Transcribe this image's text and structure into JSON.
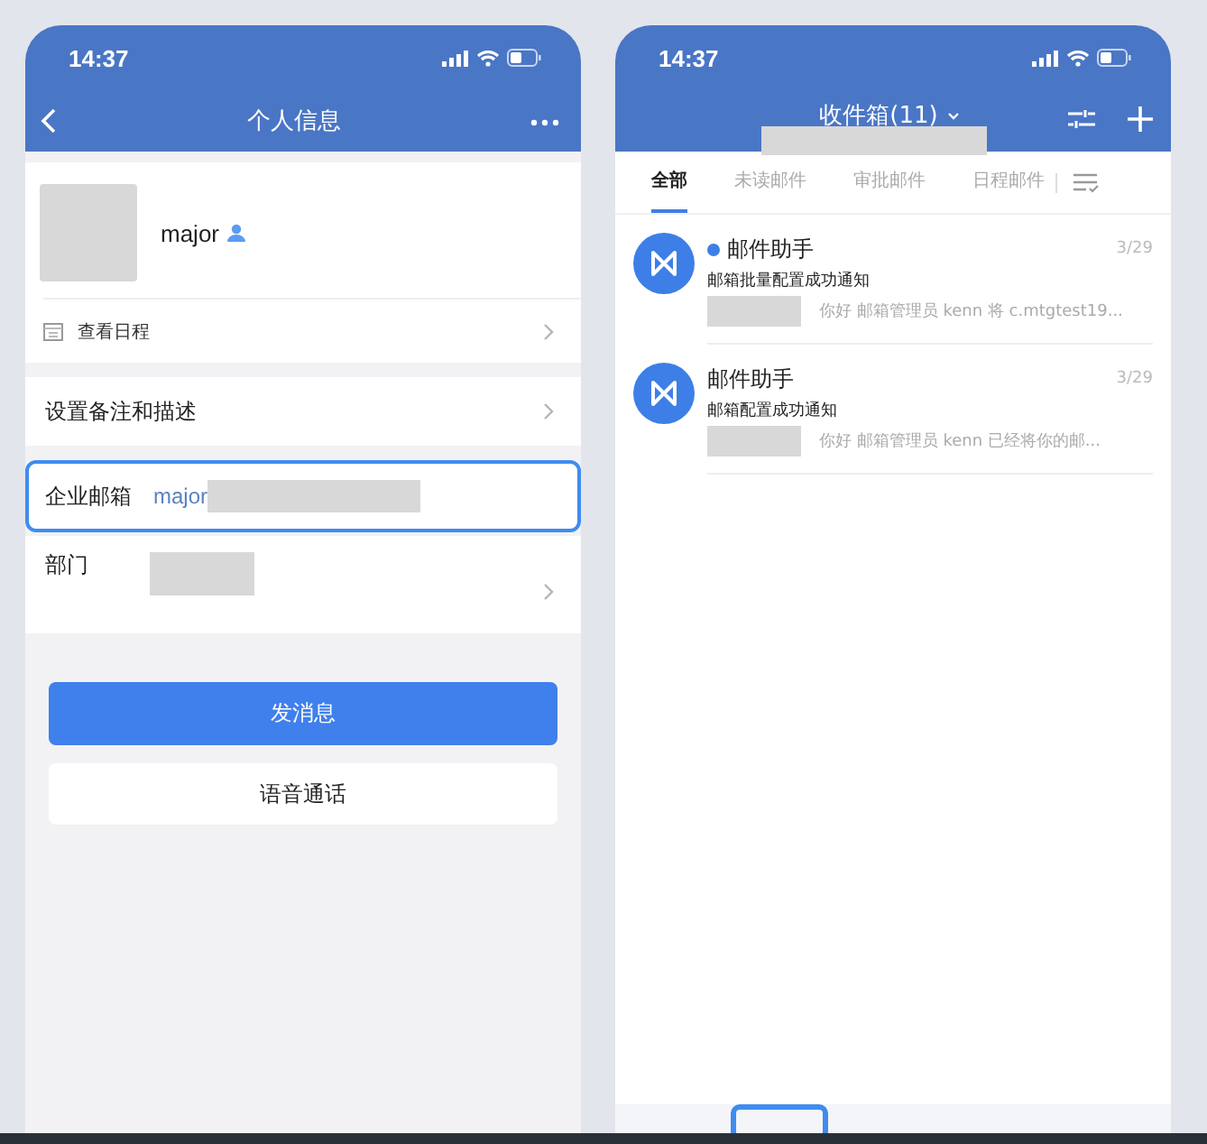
{
  "left_phone": {
    "status_bar": {
      "time": "14:37"
    },
    "nav": {
      "title": "个人信息"
    },
    "profile": {
      "name": "major",
      "schedule_link": "查看日程"
    },
    "rows": [
      {
        "kind": "link",
        "label": "设置备注和描述",
        "highlighted": false
      },
      {
        "kind": "field",
        "label": "企业邮箱",
        "value": "major",
        "redacted": true,
        "highlighted": true
      },
      {
        "kind": "department",
        "label": "部门",
        "redacted": true,
        "highlighted": false
      }
    ],
    "buttons": [
      {
        "label": "发消息",
        "kind": "primary"
      },
      {
        "label": "语音通话",
        "kind": "secondary"
      }
    ]
  },
  "right_phone": {
    "status_bar": {
      "time": "14:37"
    },
    "nav": {
      "title": "收件箱(11)",
      "subtitle_redacted": true
    },
    "tabs": [
      {
        "label": "全部",
        "selected": true
      },
      {
        "label": "未读邮件",
        "selected": false
      },
      {
        "label": "审批邮件",
        "selected": false
      },
      {
        "label": "日程邮件",
        "selected": false
      }
    ],
    "mails": [
      {
        "sender": "邮件助手",
        "unread": true,
        "date": "3/29",
        "subject": "邮箱批量配置成功通知",
        "preview": "你好 邮箱管理员 kenn 将 c.mtgtest19...",
        "preview_redacted": true
      },
      {
        "sender": "邮件助手",
        "unread": false,
        "date": "3/29",
        "subject": "邮箱配置成功通知",
        "preview": "你好 邮箱管理员 kenn 已经将你的邮...",
        "preview_redacted": true
      }
    ],
    "tab_bar": {
      "highlighted": true
    }
  }
}
